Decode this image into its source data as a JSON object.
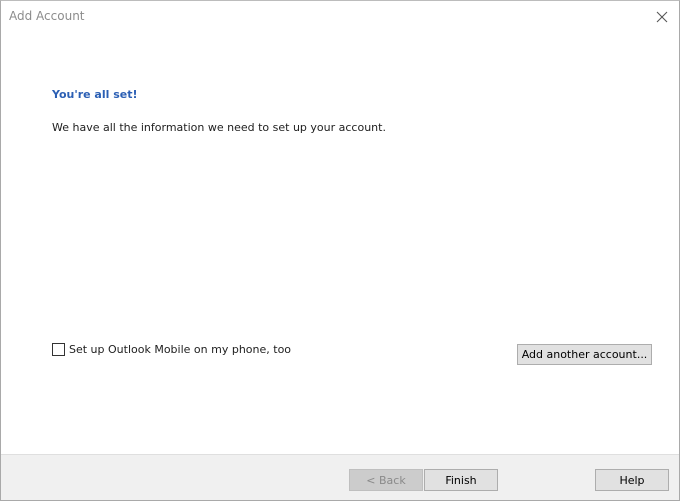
{
  "window": {
    "title": "Add Account",
    "close_glyph": "×"
  },
  "content": {
    "heading": "You're all set!",
    "message": "We have all the information we need to set up your account.",
    "mobile_checkbox_label": "Set up Outlook Mobile on my phone, too",
    "mobile_checkbox_checked": false,
    "add_another_label": "Add another account..."
  },
  "footer": {
    "back_label": "< Back",
    "back_enabled": false,
    "finish_label": "Finish",
    "help_label": "Help"
  },
  "colors": {
    "heading": "#2b5fb4",
    "footer_bg": "#f0f0f0",
    "button_bg": "#e1e1e1",
    "disabled_button_bg": "#cccccc"
  },
  "icons": {
    "close": "close-icon"
  }
}
